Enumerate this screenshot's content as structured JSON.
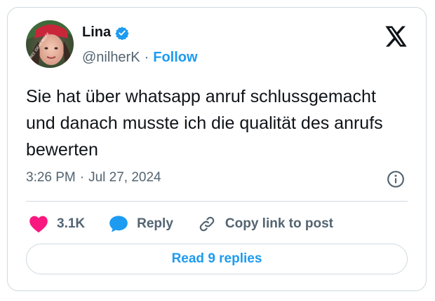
{
  "author": {
    "name": "Lina",
    "handle": "@nilherK",
    "separator": "·",
    "follow_label": "Follow",
    "avatar_text": "FREE IDEAS WORK",
    "verified_color": "#1d9bf0"
  },
  "tweet": {
    "text": "Sie hat über whatsapp anruf schlussgemacht und danach musste ich die qualität des anrufs bewerten",
    "time": "3:26 PM",
    "separator": "·",
    "date": "Jul 27, 2024"
  },
  "actions": {
    "like_count": "3.1K",
    "reply_label": "Reply",
    "copy_link_label": "Copy link to post"
  },
  "read_replies_label": "Read 9 replies",
  "icons": {
    "brand": "x-logo-icon",
    "verified": "verified-badge-icon",
    "info": "info-icon",
    "like": "heart-icon",
    "reply": "speech-bubble-icon",
    "link": "link-icon"
  },
  "colors": {
    "accent": "#1d9bf0",
    "like": "#f91880",
    "text": "#0f1419",
    "muted": "#536471",
    "border": "#cfd9de"
  }
}
